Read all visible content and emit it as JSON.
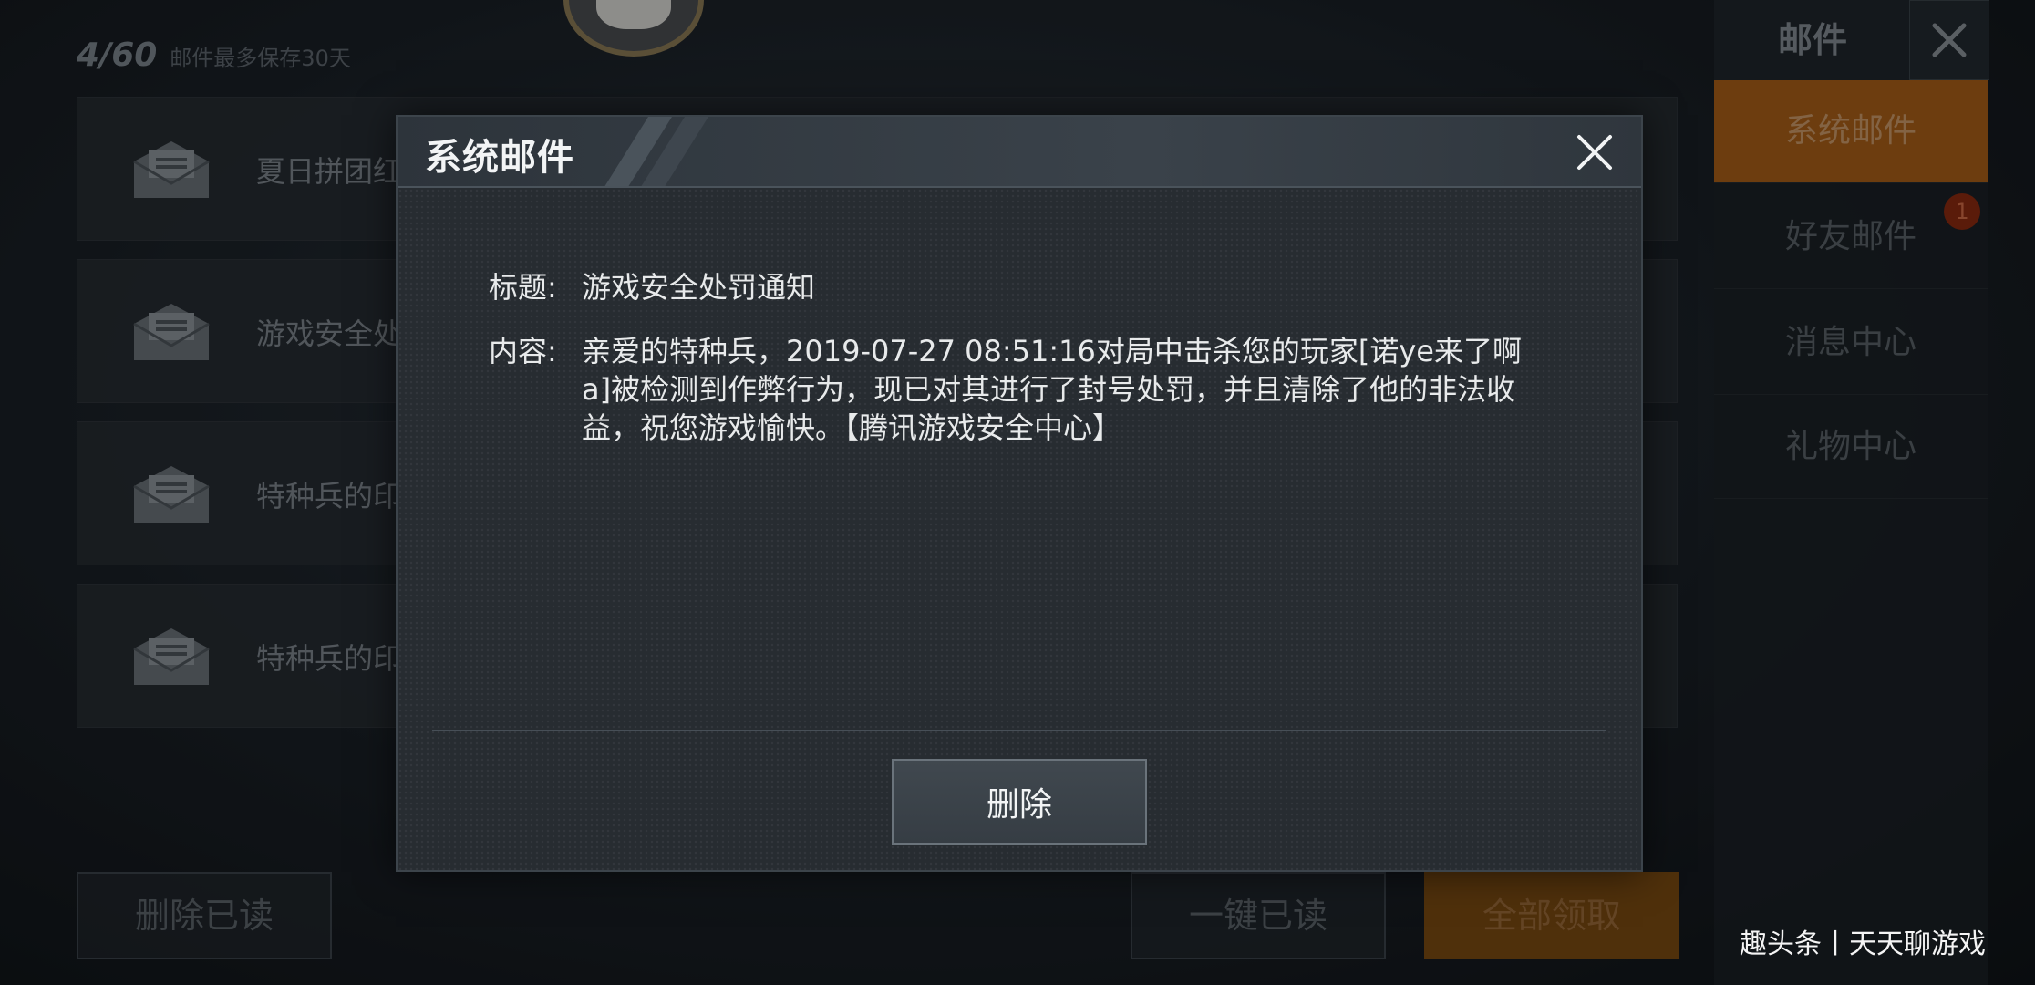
{
  "mail_header": {
    "count": "4/60",
    "note": "邮件最多保存30天"
  },
  "mail_list": [
    {
      "title": "夏日拼团红",
      "meta": ""
    },
    {
      "title": "游戏安全处",
      "meta": ""
    },
    {
      "title": "特种兵的印",
      "meta": ""
    },
    {
      "title": "特种兵的印",
      "meta": ""
    }
  ],
  "sidebar": {
    "title": "邮件",
    "items": [
      {
        "label": "系统邮件",
        "active": true
      },
      {
        "label": "好友邮件",
        "badge": "1"
      },
      {
        "label": "消息中心"
      },
      {
        "label": "礼物中心"
      }
    ]
  },
  "bottom_buttons": {
    "delete_read": "删除已读",
    "mark_all_read": "一键已读",
    "claim_all": "全部领取"
  },
  "modal": {
    "title": "系统邮件",
    "subject_label": "标题:",
    "subject": "游戏安全处罚通知",
    "content_label": "内容:",
    "content": "亲爱的特种兵，2019-07-27 08:51:16对局中击杀您的玩家[诺ye来了啊a]被检测到作弊行为，现已对其进行了封号处罚，并且清除了他的非法收益，祝您游戏愉快。【腾讯游戏安全中心】",
    "delete_label": "删除"
  },
  "watermark": "趣头条丨天天聊游戏",
  "colors": {
    "accent_orange": "#a85f18",
    "modal_bg": "#272c31",
    "text": "#e8eaeb"
  }
}
